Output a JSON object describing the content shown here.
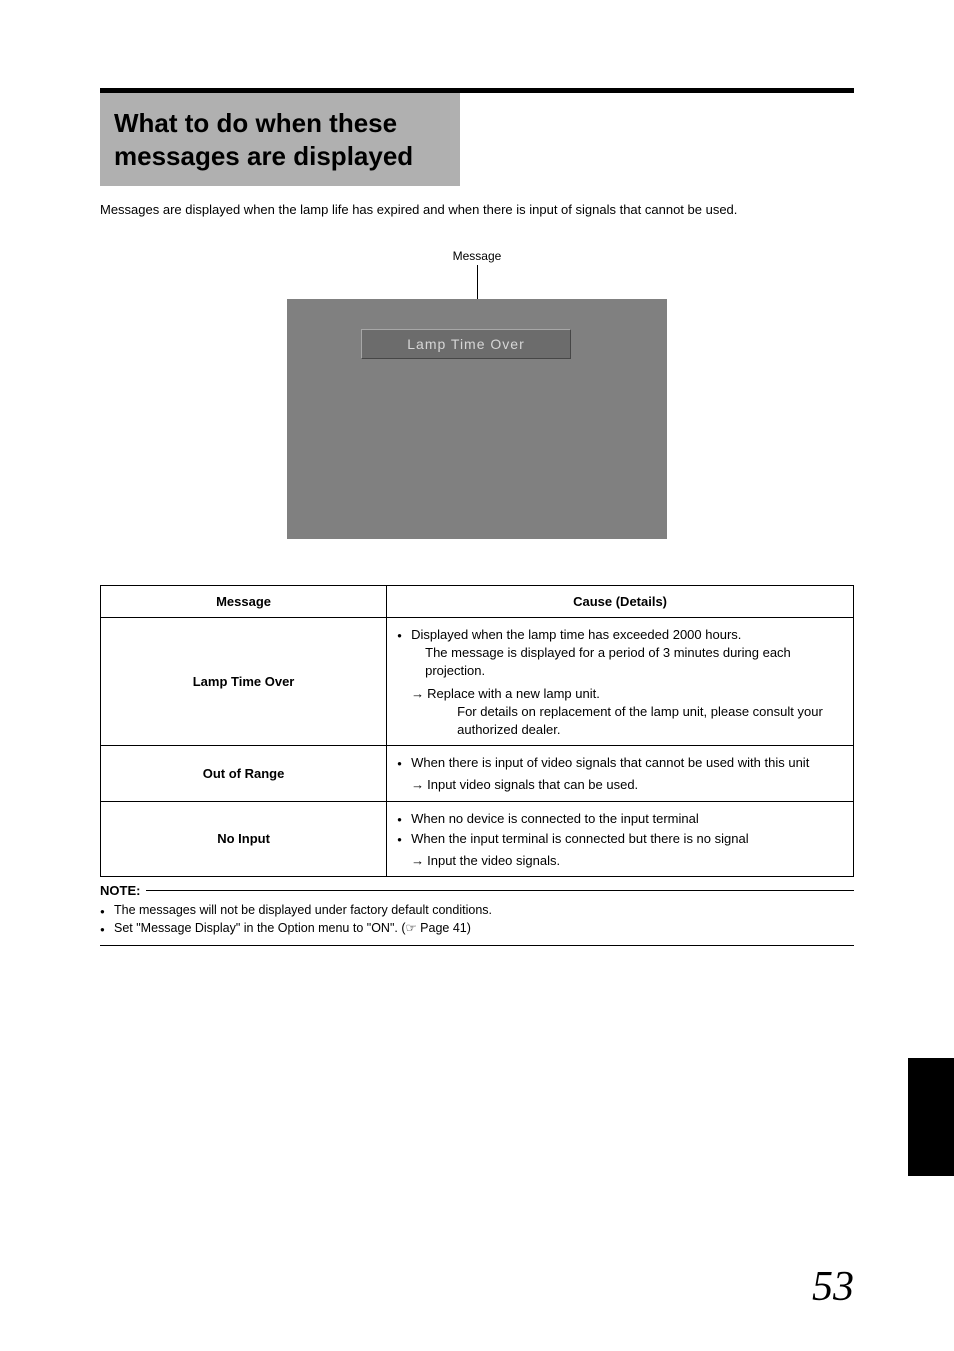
{
  "heading": "What to do when these messages are displayed",
  "intro": "Messages are displayed when the lamp life has expired and when there is input of signals that cannot be used.",
  "figure": {
    "label": "Message",
    "message_text": "Lamp Time Over"
  },
  "table": {
    "headers": {
      "col1": "Message",
      "col2": "Cause (Details)"
    },
    "rows": [
      {
        "message": "Lamp Time Over",
        "bullets": [
          "Displayed when the lamp time has exceeded 2000 hours."
        ],
        "bullet_sub": "The message is displayed for a period of 3 minutes during each projection.",
        "arrow": "Replace with a new lamp unit.",
        "arrow_sub": "For details on replacement of the lamp unit, please consult your authorized dealer."
      },
      {
        "message": "Out of Range",
        "bullets": [
          "When there is input of video signals that cannot be used with this unit"
        ],
        "arrow": "Input video signals that can be used."
      },
      {
        "message": "No Input",
        "bullets": [
          "When no device is connected to the input terminal",
          "When the input terminal is connected but there is no signal"
        ],
        "arrow": "Input the video signals."
      }
    ]
  },
  "note": {
    "label": "NOTE:",
    "items": [
      "The messages will not be displayed under factory default conditions.",
      "Set \"Message Display\" in the Option menu to \"ON\". (☞ Page 41)"
    ]
  },
  "page_number": "53"
}
